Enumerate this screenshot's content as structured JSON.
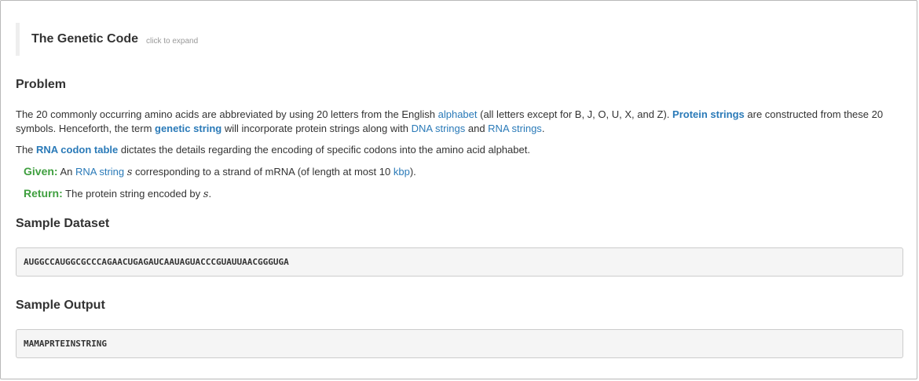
{
  "expand": {
    "title": "The Genetic Code",
    "hint": "click to expand"
  },
  "problem": {
    "heading": "Problem",
    "p1": {
      "t1": "The 20 commonly occurring amino acids are abbreviated by using 20 letters from the English ",
      "link_alphabet": "alphabet",
      "t2": " (all letters except for B, J, O, U, X, and Z). ",
      "term_protein_strings": "Protein strings",
      "t3": " are constructed from these 20 symbols. Henceforth, the term ",
      "term_genetic_string": "genetic string",
      "t4": " will incorporate protein strings along with ",
      "link_dna_strings": "DNA strings",
      "t5": " and ",
      "link_rna_strings": "RNA strings",
      "t6": "."
    },
    "p2": {
      "t1": "The ",
      "term_rna_codon_table": "RNA codon table",
      "t2": " dictates the details regarding the encoding of specific codons into the amino acid alphabet."
    },
    "given": {
      "label": "Given:",
      "t1": " An ",
      "link_rna_string": "RNA string",
      "var": "s",
      "t2": " corresponding to a strand of mRNA (of length at most 10 ",
      "link_kbp": "kbp",
      "t3": ")."
    },
    "return": {
      "label": "Return:",
      "t1": " The protein string encoded by ",
      "var": "s",
      "t2": "."
    }
  },
  "sample_dataset": {
    "heading": "Sample Dataset",
    "value": "AUGGCCAUGGCGCCCAGAACUGAGAUCAAUAGUACCCGUAUUAACGGGUGA"
  },
  "sample_output": {
    "heading": "Sample Output",
    "value": "MAMAPRTEINSTRING"
  },
  "colors": {
    "link": "#2a7ab8",
    "given_return_label": "#3f9f3f",
    "code_background": "#f5f5f5"
  }
}
